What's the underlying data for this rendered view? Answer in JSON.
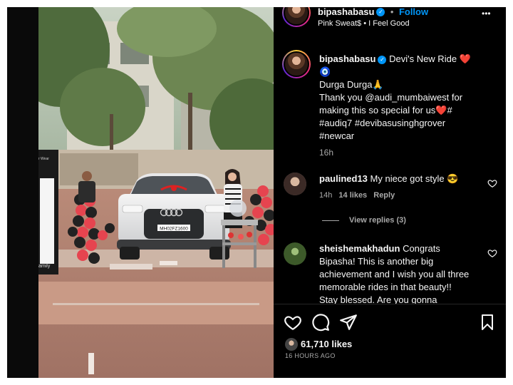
{
  "header": {
    "username": "bipashabasu",
    "separator": "•",
    "follow_label": "Follow",
    "audio": "Pink Sweat$ • I Feel Good",
    "more_glyph": "•••"
  },
  "caption": {
    "username": "bipashabasu",
    "title": "Devi's New Ride ❤️",
    "title_emoji": "🧿",
    "lines": [
      "Durga Durga🙏",
      "Thank you @audi_mumbaiwest for",
      "making this so special for us❤️#",
      "#audiq7 #devibasusinghgrover",
      "#newcar"
    ],
    "time": "16h"
  },
  "comments": [
    {
      "username": "paulined13",
      "text": "My niece got style 😎",
      "time": "14h",
      "likes": "14 likes",
      "reply": "Reply",
      "view_replies": "View replies (3)"
    },
    {
      "username": "sheishemakhadun",
      "first_line": "Congrats",
      "lines": [
        "Bipasha! This is another big",
        "achievement and I wish you all three",
        "memorable rides in that beauty!!",
        "Stay blessed. Are you gonna"
      ]
    }
  ],
  "actions": {
    "likes": "61,710 likes",
    "date": "16 HOURS AGO"
  },
  "video": {
    "plate": "MH02FZ1600",
    "banner_text": "amily",
    "banner_top_text": "r Wear"
  },
  "icons": [
    "verified-icon",
    "more-icon",
    "heart-icon",
    "comment-icon",
    "share-icon",
    "save-icon"
  ],
  "colors": {
    "accent": "#0095f6",
    "background": "#000000",
    "text": "#f5f5f5",
    "muted": "#a8a8a8"
  }
}
